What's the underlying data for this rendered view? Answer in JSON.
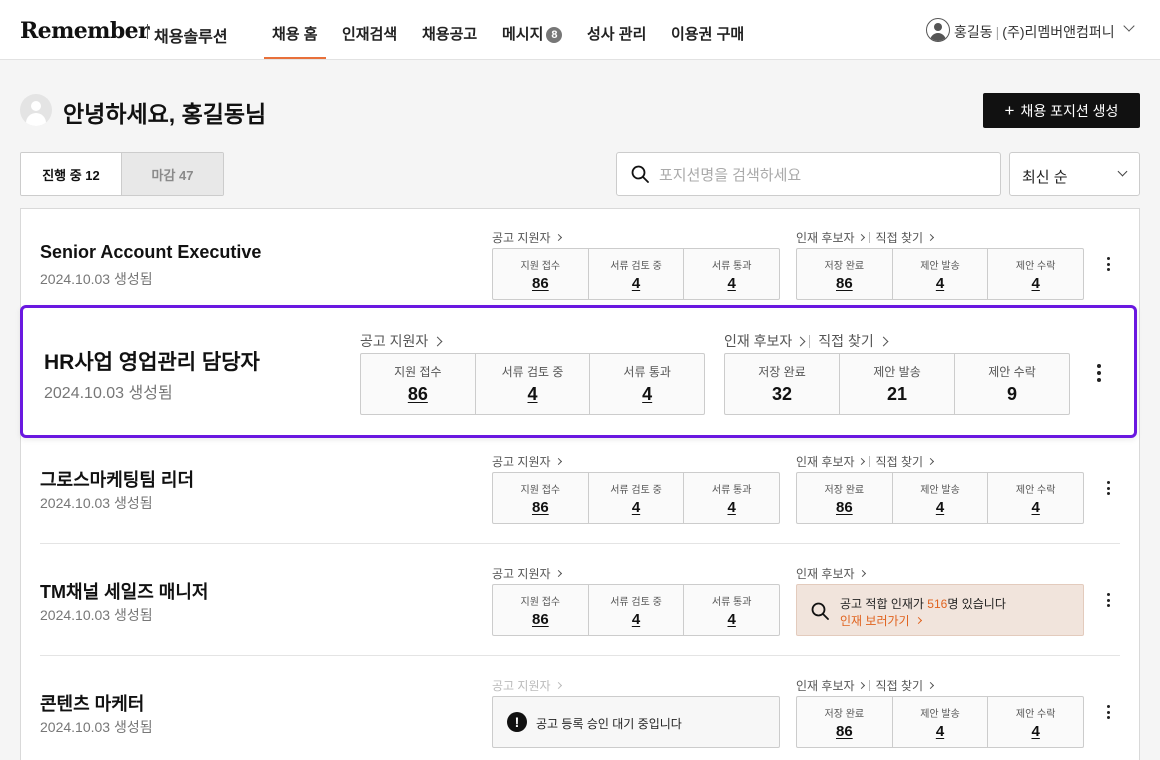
{
  "nav": {
    "logo": "Remember",
    "logo_sub": "채용솔루션",
    "menu": [
      "채용 홈",
      "인재검색",
      "채용공고",
      "메시지",
      "성사 관리",
      "이용권 구매"
    ],
    "message_badge": "8",
    "user_name": "홍길동",
    "company": "(주)리멤버앤컴퍼니"
  },
  "greeting": "안녕하세요, 홍길동님",
  "create_button": "채용 포지션 생성",
  "tabs": {
    "active": "진행 중 12",
    "inactive": "마감 47"
  },
  "search": {
    "placeholder": "포지션명을 검색하세요"
  },
  "sort": "최신 순",
  "labels": {
    "applicants": "공고 지원자",
    "candidates": "인재 후보자",
    "direct": "직접 찾기",
    "received": "지원 접수",
    "reviewing": "서류 검토 중",
    "passed": "서류 통과",
    "saved": "저장 완료",
    "offered": "제안 발송",
    "accepted": "제안 수락"
  },
  "positions": [
    {
      "title": "Senior Account Executive",
      "date": "2024.10.03 생성됨",
      "applicants": [
        "86",
        "4",
        "4"
      ],
      "candidates": [
        "86",
        "4",
        "4"
      ]
    },
    {
      "title": "HR사업 영업관리 담당자",
      "date": "2024.10.03 생성됨",
      "applicants": [
        "86",
        "4",
        "4"
      ],
      "candidates": [
        "32",
        "21",
        "9"
      ]
    },
    {
      "title": "그로스마케팅팀 리더",
      "date": "2024.10.03 생성됨",
      "applicants": [
        "86",
        "4",
        "4"
      ],
      "candidates": [
        "86",
        "4",
        "4"
      ]
    },
    {
      "title": "TM채널 세일즈 매니저",
      "date": "2024.10.03 생성됨",
      "applicants": [
        "86",
        "4",
        "4"
      ],
      "notice": {
        "prefix": "공고 적합 인재가 ",
        "count": "516",
        "suffix": "명 있습니다",
        "link": "인재 보러가기"
      }
    },
    {
      "title": "콘텐츠 마케터",
      "date": "2024.10.03 생성됨",
      "pending": "공고 등록 승인 대기 중입니다",
      "candidates": [
        "86",
        "4",
        "4"
      ]
    }
  ],
  "colors": {
    "accent": "#e8703a",
    "highlight": "#6a18e0",
    "notice_bg": "#f1e4dc"
  }
}
